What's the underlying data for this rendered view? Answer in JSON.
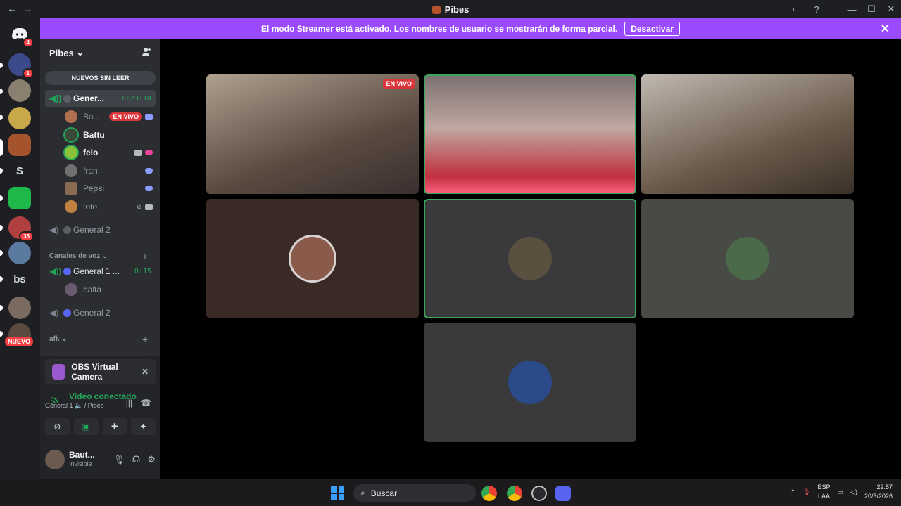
{
  "window": {
    "title": "Pibes",
    "nav_back": "←",
    "nav_fwd": "→"
  },
  "window_controls": {
    "inbox": "▭",
    "help": "?",
    "minimize": "—",
    "maximize": "☐",
    "close": "✕"
  },
  "banner": {
    "text": "El modo Streamer está activado. Los nombres de usuario se mostrarán de forma parcial.",
    "button": "Desactivar",
    "close": "✕"
  },
  "guilds": {
    "items": [
      {
        "name": "discord-home",
        "badge": "4",
        "color": "#1e1f22"
      },
      {
        "name": "server-1",
        "badge": "1",
        "color": "#3a4a8a"
      },
      {
        "name": "server-2",
        "badge": "",
        "color": "#8a8070"
      },
      {
        "name": "server-3",
        "badge": "",
        "color": "#c9a84a"
      },
      {
        "name": "server-4",
        "badge": "",
        "color": "#a4532c"
      },
      {
        "name": "server-s",
        "label": "S",
        "badge": ""
      },
      {
        "name": "server-k",
        "badge": "",
        "color": "#1fb84a"
      },
      {
        "name": "server-6",
        "badge": "35",
        "color": "#b04040"
      },
      {
        "name": "server-7",
        "badge": "",
        "color": "#5a7aa0"
      },
      {
        "name": "server-bs",
        "label": "bs",
        "badge": ""
      },
      {
        "name": "server-9",
        "badge": "",
        "color": "#7a6a60"
      },
      {
        "name": "server-10",
        "badge": "",
        "color": "#5a4a40"
      }
    ],
    "new_label": "NUEVO"
  },
  "sidebar": {
    "server_name": "Pibes",
    "server_chevron": "⌄",
    "unread_button": "NUEVOS SIN LEER",
    "active_channel": {
      "name": "Gener...",
      "timer": "8:23:18"
    },
    "users": [
      {
        "name": "Ba...",
        "live": "EN VIVO",
        "color": "#b07050"
      },
      {
        "name": "Battu",
        "color": "#3a4a3a"
      },
      {
        "name": "felo",
        "color": "#8ac23a"
      },
      {
        "name": "fran",
        "color": "#707070"
      },
      {
        "name": "Pepsi",
        "color": "#8a6a50"
      },
      {
        "name": "toto",
        "color": "#c08040"
      }
    ],
    "general2": "General 2",
    "category_voice": "Canales de voz",
    "voice_channel_1": {
      "name": "General 1 ...",
      "timer": "0:15"
    },
    "voice_user": "balta",
    "general2b": "General 2",
    "category_afk": "afk"
  },
  "panel": {
    "obs_title": "OBS Virtual Camera",
    "video_status": "Video conectado",
    "video_sub": "General 1 🔈 / Pibes",
    "user_name": "Baut...",
    "user_status": "Invisible"
  },
  "stage": {
    "live_tag": "EN VIVO",
    "tiles": [
      {
        "name": "tile-stream",
        "bg": "#5a4a40",
        "speaking": false
      },
      {
        "name": "tile-cam-2",
        "bg": "#6e5a58",
        "speaking": true
      },
      {
        "name": "tile-cam-3",
        "bg": "#7a6a5a",
        "speaking": false
      },
      {
        "name": "tile-avatar-1",
        "bg": "#3a2a26",
        "speaking": false
      },
      {
        "name": "tile-avatar-2",
        "bg": "#3a3a3c",
        "speaking": true
      },
      {
        "name": "tile-avatar-3",
        "bg": "#484a46",
        "speaking": false
      },
      {
        "name": "tile-avatar-4",
        "bg": "#3a3a3c",
        "speaking": false
      }
    ]
  },
  "taskbar": {
    "search": "Buscar",
    "lang_1": "ESP",
    "lang_2": "LAA",
    "time": "22:57",
    "date": "20/3/2026"
  }
}
